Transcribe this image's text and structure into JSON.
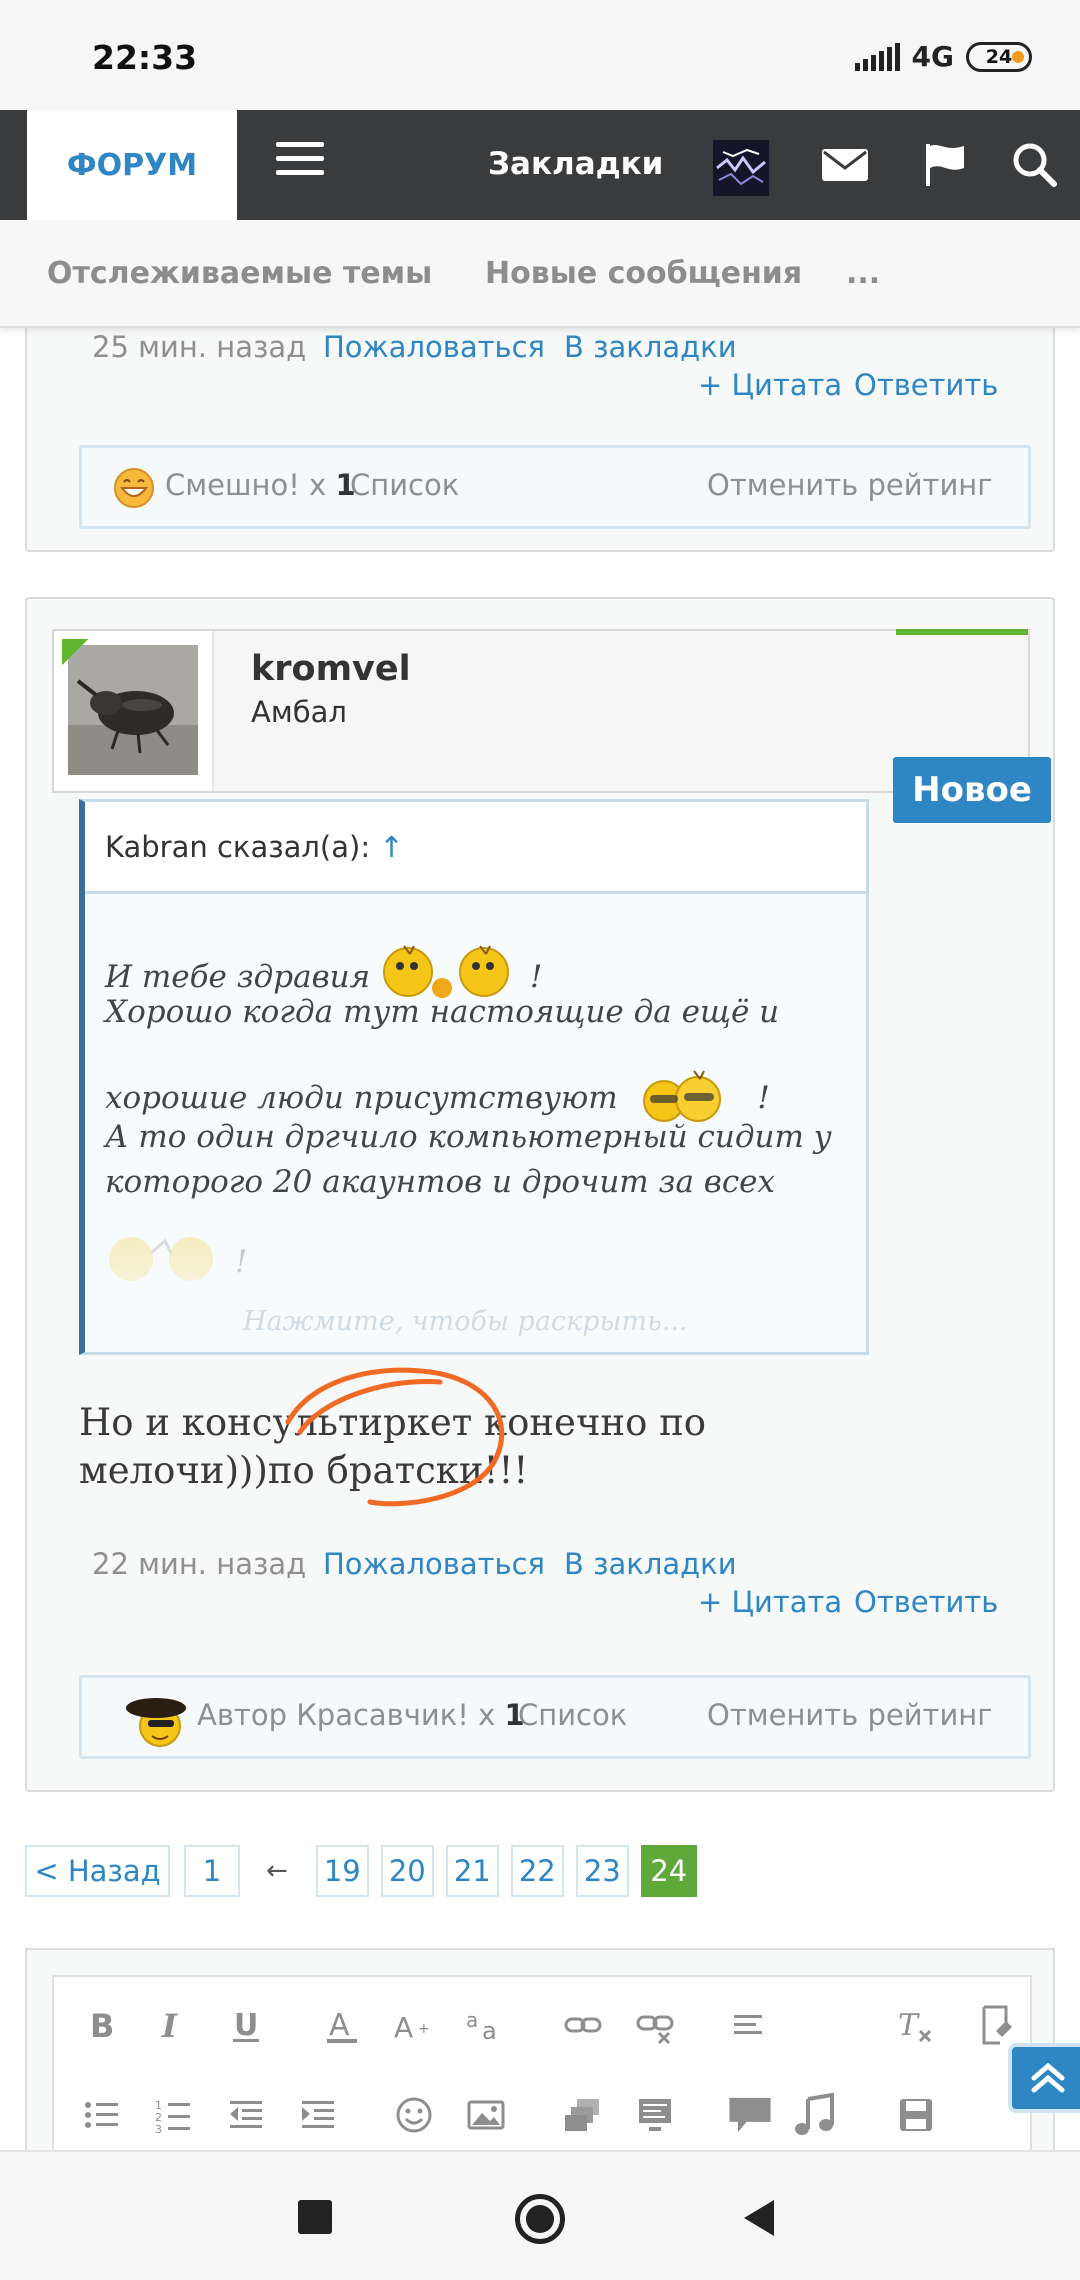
{
  "status_bar": {
    "time": "22:33",
    "network": "4G",
    "battery": "24"
  },
  "nav": {
    "forum_tab": "ФОРУМ",
    "bookmarks": "Закладки"
  },
  "subnav": {
    "items": [
      "Отслеживаемые темы",
      "Новые сообщения",
      "..."
    ]
  },
  "post1": {
    "time": "25 мин. назад",
    "report": "Пожаловаться",
    "bookmark": "В закладки",
    "quote": "+ Цитата",
    "reply": "Ответить",
    "rating": {
      "label": "Смешно! x",
      "count": "1",
      "list": "Список",
      "cancel": "Отменить рейтинг"
    }
  },
  "post2": {
    "username": "kromvel",
    "user_title": "Амбал",
    "badge": "Новое",
    "quote_author": "Kabran сказал(а):",
    "quote_arrow": "↑",
    "quote_lines": [
      "И тебе здравия",
      "!",
      "Хорошо когда тут настоящие да ещё и",
      "хорошие люди присутствуют",
      "!",
      "А то один дргчило компьютерный сидит у",
      "которого 20 акаунтов и дрочит за всех",
      "!"
    ],
    "quote_expand": "Нажмите, чтобы раскрыть...",
    "message_line1": "Но и консультиркет конечно по",
    "message_line2": "мелочи)))по братски!!!",
    "time": "22 мин. назад",
    "report": "Пожаловаться",
    "bookmark": "В закладки",
    "quote": "+ Цитата",
    "reply": "Ответить",
    "rating": {
      "label": "Автор Красавчик! x",
      "count": "1",
      "list": "Список",
      "cancel": "Отменить рейтинг"
    }
  },
  "pagination": {
    "prev": "< Назад",
    "pages": [
      "1",
      "19",
      "20",
      "21",
      "22",
      "23",
      "24"
    ],
    "gap": "←",
    "current": "24"
  },
  "editor": {
    "toolbar_row1": [
      "bold-icon",
      "italic-icon",
      "underline-icon",
      "text-color-icon",
      "font-size-icon",
      "font-family-icon",
      "link-icon",
      "unlink-icon",
      "align-icon",
      "remove-format-icon",
      "undo-icon"
    ],
    "toolbar_row2": [
      "bullet-list-icon",
      "number-list-icon",
      "outdent-icon",
      "indent-icon",
      "smilies-icon",
      "image-icon",
      "media-icon",
      "code-icon",
      "chat-icon",
      "music-icon",
      "save-icon"
    ]
  },
  "colors": {
    "accent": "#2f86c4",
    "nav_bg": "#3a3b3c",
    "current_page": "#5fa93b",
    "annotation": "#f06a24"
  }
}
